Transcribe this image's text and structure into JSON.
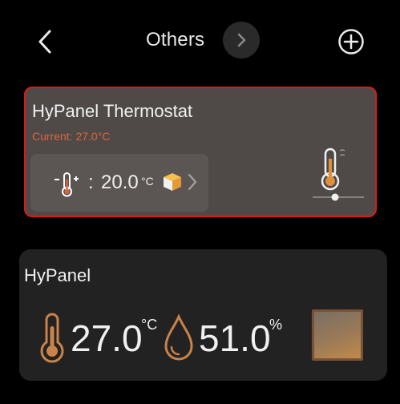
{
  "header": {
    "title": "Others",
    "back_icon": "chevron-left-icon",
    "next_icon": "chevron-right-icon",
    "add_icon": "plus-circle-icon"
  },
  "devices": [
    {
      "name": "HyPanel Thermostat",
      "current": "Current: 27.0°C",
      "setpoint": {
        "value": "20.0",
        "unit": "°C",
        "icon": "thermometer-adjust-icon",
        "mode_icon": "box-icon"
      },
      "control_icon": "thermostat-slider-icon",
      "selected": true,
      "accent_color": "#e0633a",
      "selection_color": "#d51c1c"
    },
    {
      "name": "HyPanel",
      "temperature": {
        "value": "27.0",
        "unit": "°C",
        "icon": "thermometer-icon"
      },
      "humidity": {
        "value": "51.0",
        "unit": "%",
        "icon": "droplet-icon"
      },
      "panel_icon": "panel-square-icon",
      "icon_color": "#c8834a"
    }
  ]
}
